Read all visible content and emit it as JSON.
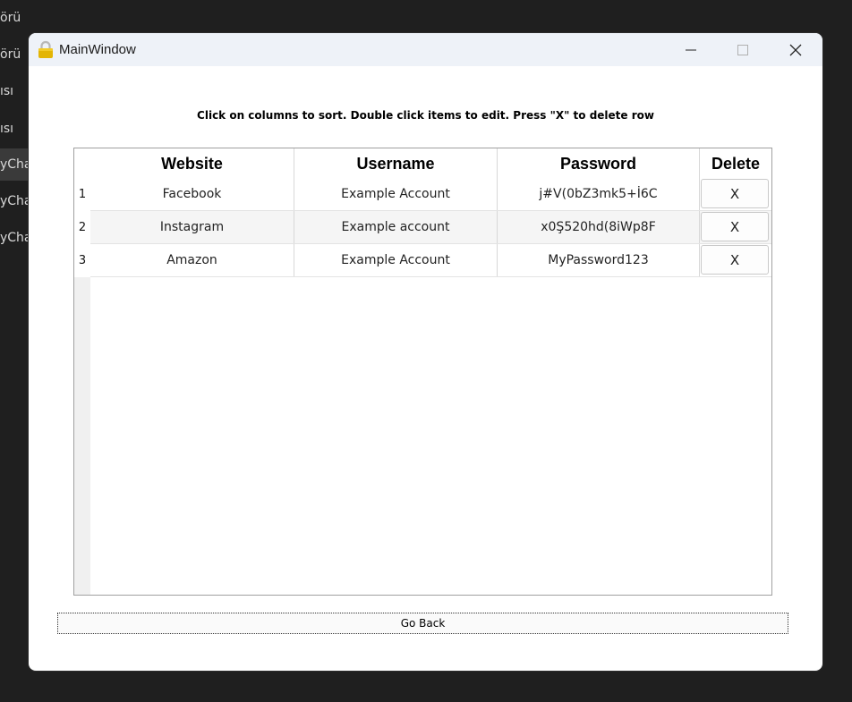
{
  "background_app": {
    "sidebar_items": [
      "örü",
      "örü",
      "ısı",
      "ısı",
      "yChar",
      "yChar",
      "yChar"
    ]
  },
  "window": {
    "title": "MainWindow",
    "icon": "lock-icon"
  },
  "instruction": "Click on columns to sort. Double click items to edit. Press \"X\" to delete row",
  "table": {
    "columns": [
      "Website",
      "Username",
      "Password",
      "Delete"
    ],
    "rows": [
      {
        "num": "1",
        "website": "Facebook",
        "username": "Example Account",
        "password": "j#V(0bZ3mk5+İ6C",
        "delete": "X"
      },
      {
        "num": "2",
        "website": "Instagram",
        "username": "Example account",
        "password": "x0Ş520hd(8iWp8F",
        "delete": "X"
      },
      {
        "num": "3",
        "website": "Amazon",
        "username": "Example Account",
        "password": "MyPassword123",
        "delete": "X"
      }
    ]
  },
  "go_back_label": "Go Back",
  "colors": {
    "lock_icon": "#e3b505",
    "titlebar": "#eef2f8"
  }
}
